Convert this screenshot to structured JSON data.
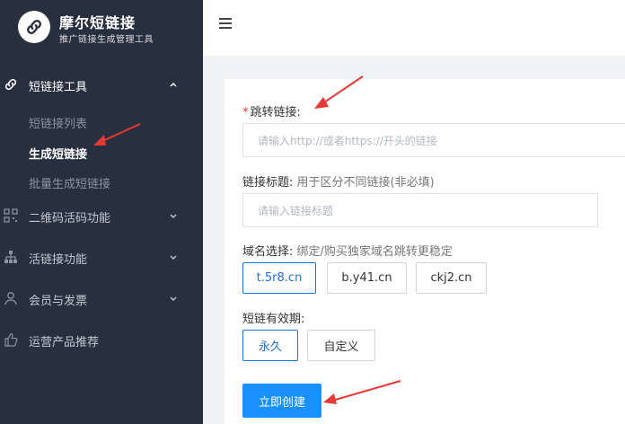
{
  "brand": {
    "title": "摩尔短链接",
    "subtitle": "推广链接生成管理工具"
  },
  "sidebar": {
    "items": [
      {
        "label": "短链接工具",
        "icon": "link-icon",
        "expanded": true
      },
      {
        "label": "二维码活码功能",
        "icon": "qrcode-icon",
        "expanded": false
      },
      {
        "label": "活链接功能",
        "icon": "sitemap-icon",
        "expanded": false
      },
      {
        "label": "会员与发票",
        "icon": "user-icon",
        "expanded": false
      },
      {
        "label": "运营产品推荐",
        "icon": "thumbs-up-icon",
        "expanded": false
      }
    ],
    "sub_items": [
      {
        "label": "短链接列表",
        "active": false
      },
      {
        "label": "生成短链接",
        "active": true
      },
      {
        "label": "批量生成短链接",
        "active": false
      }
    ]
  },
  "form": {
    "redirect": {
      "required_mark": "*",
      "label": "跳转链接:",
      "placeholder": "请输入http://或者https://开头的链接"
    },
    "title_field": {
      "label": "链接标题:",
      "hint": "用于区分不同链接(非必填)",
      "placeholder": "请输入链接标题"
    },
    "domain": {
      "label": "域名选择:",
      "hint": "绑定/购买独家域名跳转更稳定",
      "options": [
        "t.5r8.cn",
        "b.y41.cn",
        "ckj2.cn"
      ],
      "selected": "t.5r8.cn"
    },
    "validity": {
      "label": "短链有效期:",
      "options": [
        "永久",
        "自定义"
      ],
      "selected": "永久"
    },
    "submit_label": "立即创建"
  },
  "colors": {
    "sidebar_bg": "#28303f",
    "primary": "#1890ff",
    "selected_border": "#1e6fd9",
    "annotation_arrow": "#e53935"
  }
}
